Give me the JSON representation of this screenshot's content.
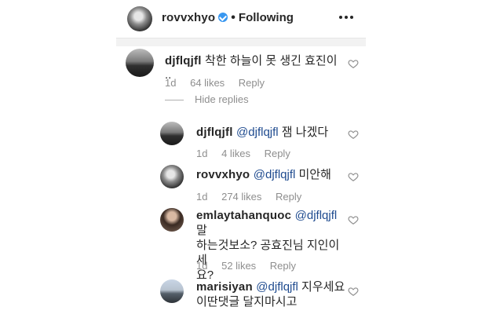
{
  "header": {
    "username": "rovvxhyo",
    "separator": "•",
    "follow_label": "Following"
  },
  "comment": {
    "username": "djflqjfl",
    "text": "착한 하늘이 못 생긴 효진이 ..",
    "time": "1d",
    "likes": "64 likes",
    "reply": "Reply",
    "hide_replies": "Hide replies"
  },
  "replies": [
    {
      "username": "djflqjfl",
      "mention": "@djflqjfl",
      "text": " 잼 나겠다",
      "time": "1d",
      "likes": "4 likes",
      "reply": "Reply"
    },
    {
      "username": "rovvxhyo",
      "mention": "@djflqjfl",
      "text": " 미안해",
      "time": "1d",
      "likes": "274 likes",
      "reply": "Reply"
    },
    {
      "username": "emlaytahanquoc",
      "mention": "@djflqjfl",
      "text_line1": " 말",
      "text_line2": "하는것보소? 공효진님 지인이세",
      "text_line3": "요?",
      "time": "1d",
      "likes": "52 likes",
      "reply": "Reply"
    },
    {
      "username": "marisiyan",
      "mention": "@djflqjfl",
      "text_line1": " 지우세요",
      "text_line2": "이딴댓글 달지마시고"
    }
  ],
  "icons": {
    "more": "more-horizontal-icon",
    "verified": "verified-badge-icon",
    "heart": "heart-outline-icon"
  },
  "colors": {
    "mention": "#1f4b8f",
    "verified": "#3897f0",
    "meta": "#8e8e8e"
  }
}
